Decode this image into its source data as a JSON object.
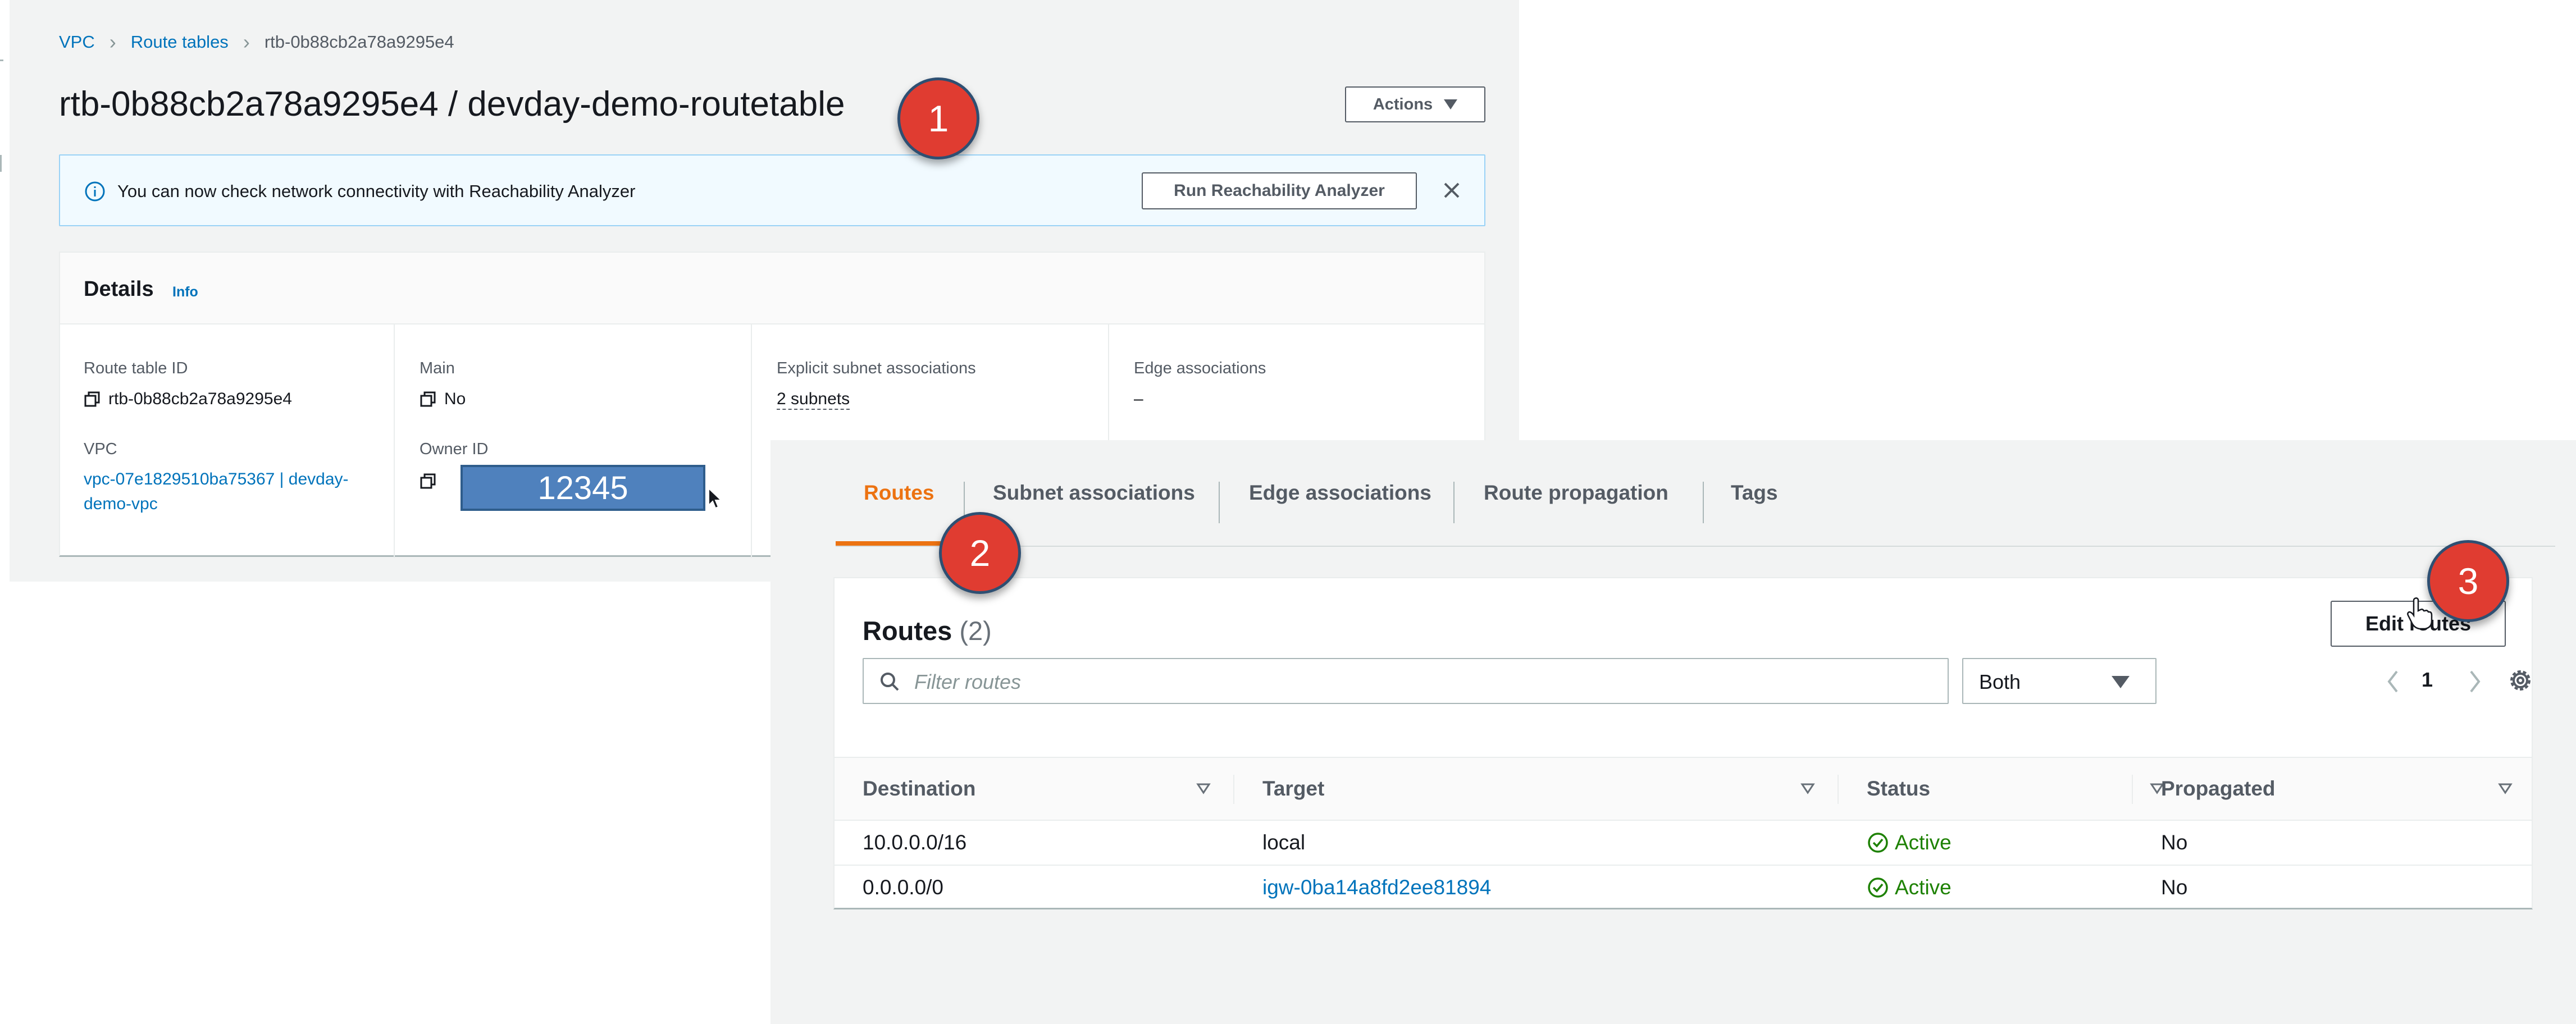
{
  "breadcrumb": {
    "vpc": "VPC",
    "route_tables": "Route tables",
    "current": "rtb-0b88cb2a78a9295e4"
  },
  "header": {
    "title": "rtb-0b88cb2a78a9295e4 / devday-demo-routetable",
    "actions_label": "Actions"
  },
  "flash": {
    "message": "You can now check network connectivity with Reachability Analyzer",
    "button_label": "Run Reachability Analyzer"
  },
  "details": {
    "title": "Details",
    "info_link": "Info",
    "route_table_id_label": "Route table ID",
    "route_table_id_value": "rtb-0b88cb2a78a9295e4",
    "main_label": "Main",
    "main_value": "No",
    "explicit_label": "Explicit subnet associations",
    "explicit_value": "2 subnets",
    "edge_label": "Edge associations",
    "edge_value": "–",
    "vpc_label": "VPC",
    "vpc_value": "vpc-07e1829510ba75367 | devday-demo-vpc",
    "owner_label": "Owner ID",
    "owner_value": "12345"
  },
  "tabs": [
    {
      "label": "Routes",
      "active": true
    },
    {
      "label": "Subnet associations",
      "active": false
    },
    {
      "label": "Edge associations",
      "active": false
    },
    {
      "label": "Route propagation",
      "active": false
    },
    {
      "label": "Tags",
      "active": false
    }
  ],
  "routes": {
    "title": "Routes",
    "count": "(2)",
    "edit_button": "Edit routes",
    "filter_placeholder": "Filter routes",
    "filter_value": "",
    "select_value": "Both",
    "page": "1",
    "columns": [
      "Destination",
      "Target",
      "Status",
      "Propagated"
    ],
    "rows": [
      {
        "destination": "10.0.0.0/16",
        "target": "local",
        "target_link": false,
        "status": "Active",
        "propagated": "No"
      },
      {
        "destination": "0.0.0.0/0",
        "target": "igw-0ba14a8fd2ee81894",
        "target_link": true,
        "status": "Active",
        "propagated": "No"
      }
    ]
  },
  "markers": [
    "1",
    "2",
    "3"
  ],
  "colors": {
    "link": "#0073bb",
    "active_tab": "#ec7211",
    "status_active": "#1d8102",
    "marker": "#e03c31",
    "owner_mask": "#4f81bd"
  },
  "icons": [
    "info-icon",
    "close-icon",
    "copy-icon",
    "search-icon",
    "chevron-left-icon",
    "chevron-right-icon",
    "settings-icon",
    "sort-icon",
    "check-circle-icon",
    "cursor-icon"
  ]
}
